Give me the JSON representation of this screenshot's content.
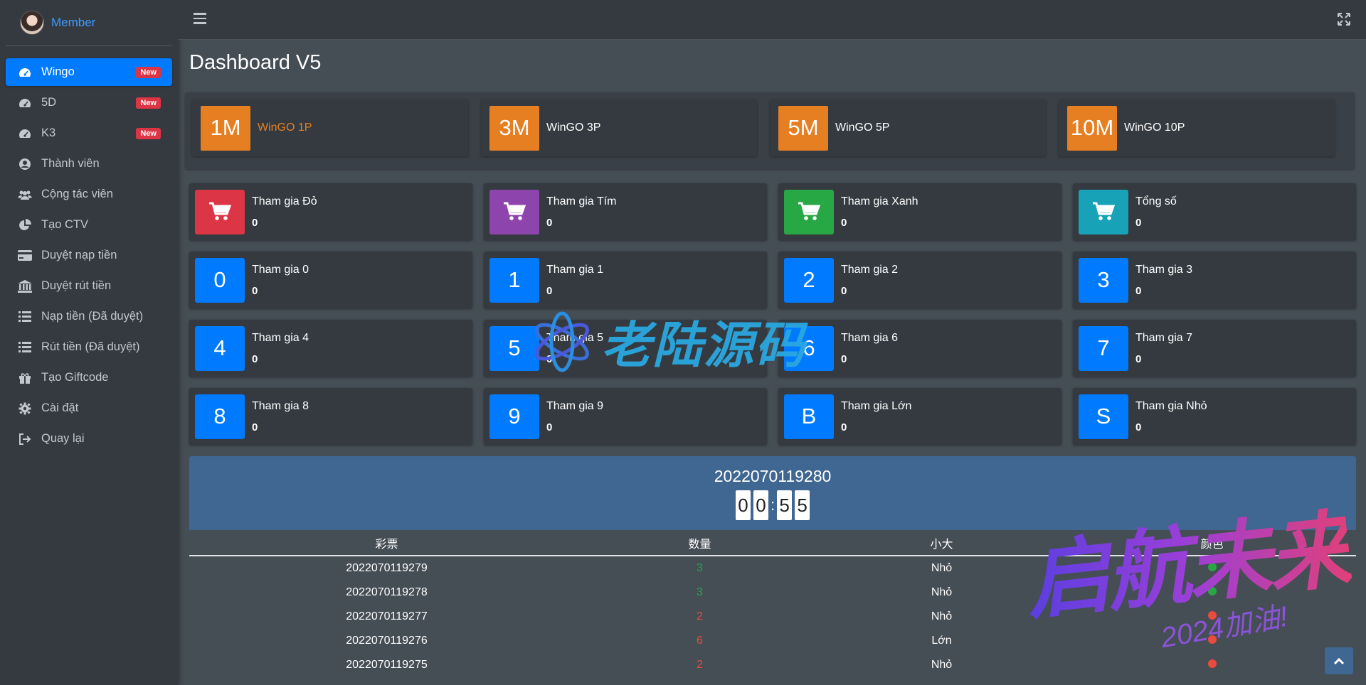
{
  "sidebar": {
    "user": {
      "name": "Member"
    },
    "items": [
      {
        "label": "Wingo",
        "badge": "New",
        "icon": "gauge-icon"
      },
      {
        "label": "5D",
        "badge": "New",
        "icon": "gauge-icon"
      },
      {
        "label": "K3",
        "badge": "New",
        "icon": "gauge-icon"
      },
      {
        "label": "Thành viên",
        "icon": "user-circle-icon"
      },
      {
        "label": "Cộng tác viên",
        "icon": "users-icon"
      },
      {
        "label": "Tạo CTV",
        "icon": "pie-chart-icon"
      },
      {
        "label": "Duyệt nạp tiền",
        "icon": "credit-card-icon"
      },
      {
        "label": "Duyệt rút tiền",
        "icon": "bank-icon"
      },
      {
        "label": "Nạp tiền (Đã duyệt)",
        "icon": "list-icon"
      },
      {
        "label": "Rút tiền (Đã duyệt)",
        "icon": "list-icon"
      },
      {
        "label": "Tạo Giftcode",
        "icon": "gift-icon"
      },
      {
        "label": "Cài đặt",
        "icon": "gear-icon"
      },
      {
        "label": "Quay lại",
        "icon": "sign-out-icon"
      }
    ]
  },
  "main": {
    "title": "Dashboard V5",
    "games": [
      {
        "icon_text": "1M",
        "label": "WinGO 1P"
      },
      {
        "icon_text": "3M",
        "label": "WinGO 3P"
      },
      {
        "icon_text": "5M",
        "label": "WinGO 5P"
      },
      {
        "icon_text": "10M",
        "label": "WinGO 10P"
      }
    ],
    "color_stats": [
      {
        "label": "Tham gia Đỏ",
        "value": "0",
        "color": "#dc3545",
        "icon": "cart-icon"
      },
      {
        "label": "Tham gia Tím",
        "value": "0",
        "color": "#8e44ad",
        "icon": "cart-icon"
      },
      {
        "label": "Tham gia Xanh",
        "value": "0",
        "color": "#28a745",
        "icon": "cart-icon"
      },
      {
        "label": "Tổng số",
        "value": "0",
        "color": "#17a2b8",
        "icon": "cart-icon"
      }
    ],
    "number_stats": [
      {
        "icon_text": "0",
        "label": "Tham gia 0",
        "value": "0"
      },
      {
        "icon_text": "1",
        "label": "Tham gia 1",
        "value": "0"
      },
      {
        "icon_text": "2",
        "label": "Tham gia 2",
        "value": "0"
      },
      {
        "icon_text": "3",
        "label": "Tham gia 3",
        "value": "0"
      },
      {
        "icon_text": "4",
        "label": "Tham gia 4",
        "value": "0"
      },
      {
        "icon_text": "5",
        "label": "Tham gia 5",
        "value": "0"
      },
      {
        "icon_text": "6",
        "label": "Tham gia 6",
        "value": "0"
      },
      {
        "icon_text": "7",
        "label": "Tham gia 7",
        "value": "0"
      },
      {
        "icon_text": "8",
        "label": "Tham gia 8",
        "value": "0"
      },
      {
        "icon_text": "9",
        "label": "Tham gia 9",
        "value": "0"
      },
      {
        "icon_text": "B",
        "label": "Tham gia Lớn",
        "value": "0"
      },
      {
        "icon_text": "S",
        "label": "Tham gia Nhỏ",
        "value": "0"
      }
    ],
    "period": {
      "id": "2022070119280",
      "countdown": [
        "0",
        "0",
        "5",
        "5"
      ]
    },
    "table": {
      "headers": [
        "彩票",
        "数量",
        "小大",
        "颜色"
      ],
      "rows": [
        {
          "period": "2022070119279",
          "number": "3",
          "size": "Nhỏ",
          "color": "green"
        },
        {
          "period": "2022070119278",
          "number": "3",
          "size": "Nhỏ",
          "color": "green"
        },
        {
          "period": "2022070119277",
          "number": "2",
          "size": "Nhỏ",
          "color": "red"
        },
        {
          "period": "2022070119276",
          "number": "6",
          "size": "Lớn",
          "color": "red"
        },
        {
          "period": "2022070119275",
          "number": "2",
          "size": "Nhỏ",
          "color": "red"
        }
      ]
    }
  },
  "watermarks": {
    "center": "老陆源码",
    "corner": "启航未来",
    "corner_sub": "2024加油!"
  },
  "colors": {
    "accent": "#007bff",
    "orange": "#e67e22",
    "sidebar_bg": "#343a40",
    "content_bg": "#454d55",
    "period_bg": "#3f6791"
  }
}
